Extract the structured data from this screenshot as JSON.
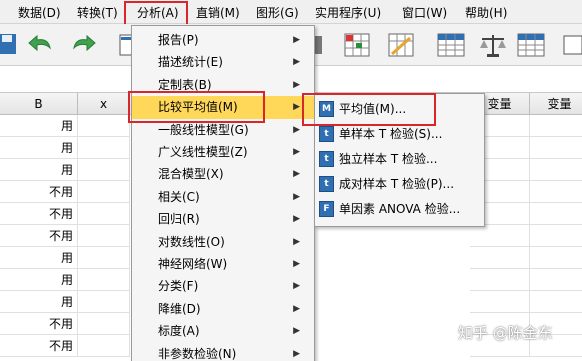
{
  "menubar": {
    "items": [
      {
        "label": "数据(D)"
      },
      {
        "label": "转换(T)"
      },
      {
        "label": "分析(A)"
      },
      {
        "label": "直销(M)"
      },
      {
        "label": "图形(G)"
      },
      {
        "label": "实用程序(U)"
      },
      {
        "label": "窗口(W)"
      },
      {
        "label": "帮助(H)"
      }
    ]
  },
  "grid": {
    "columns": [
      "B",
      "x",
      "变量",
      "变量"
    ],
    "column_b_values": [
      "用",
      "用",
      "用",
      "不用",
      "不用",
      "不用",
      "用",
      "用",
      "用",
      "不用",
      "不用"
    ]
  },
  "analyze_menu": {
    "items": [
      {
        "label": "报告(P)",
        "has_submenu": true
      },
      {
        "label": "描述统计(E)",
        "has_submenu": true
      },
      {
        "label": "定制表(B)",
        "has_submenu": true
      },
      {
        "label": "比较平均值(M)",
        "has_submenu": true,
        "active": true
      },
      {
        "label": "一般线性模型(G)",
        "has_submenu": true
      },
      {
        "label": "广义线性模型(Z)",
        "has_submenu": true
      },
      {
        "label": "混合模型(X)",
        "has_submenu": true
      },
      {
        "label": "相关(C)",
        "has_submenu": true
      },
      {
        "label": "回归(R)",
        "has_submenu": true
      },
      {
        "label": "对数线性(O)",
        "has_submenu": true
      },
      {
        "label": "神经网络(W)",
        "has_submenu": true
      },
      {
        "label": "分类(F)",
        "has_submenu": true
      },
      {
        "label": "降维(D)",
        "has_submenu": true
      },
      {
        "label": "标度(A)",
        "has_submenu": true
      },
      {
        "label": "非参数检验(N)",
        "has_submenu": true
      }
    ]
  },
  "compare_means_submenu": {
    "items": [
      {
        "label": "平均值(M)...",
        "icon": "M"
      },
      {
        "label": "单样本 T 检验(S)...",
        "icon": "t"
      },
      {
        "label": "独立样本 T 检验...",
        "icon": "t"
      },
      {
        "label": "成对样本 T 检验(P)...",
        "icon": "t"
      },
      {
        "label": "单因素 ANOVA 检验...",
        "icon": "F"
      }
    ]
  },
  "watermark": "知乎 @陈金东",
  "colors": {
    "highlight_box": "#d9262c",
    "menu_active": "#ffd85a",
    "toolbar_bg": "#f2f2f2"
  }
}
